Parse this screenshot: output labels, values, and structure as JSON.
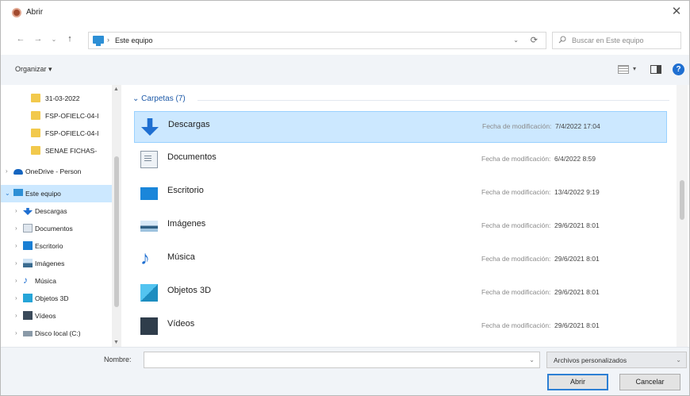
{
  "window": {
    "title": "Abrir"
  },
  "address": {
    "path": "Este equipo",
    "search_placeholder": "Buscar en Este equipo"
  },
  "toolbar": {
    "organize_label": "Organizar ▾"
  },
  "nav": {
    "items": [
      {
        "label": "31-03-2022",
        "icon": "folder-icon"
      },
      {
        "label": "FSP-OFIELC-04-I",
        "icon": "folder-icon"
      },
      {
        "label": "FSP-OFIELC-04-I",
        "icon": "folder-icon"
      },
      {
        "label": "SENAE FICHAS-",
        "icon": "folder-icon"
      },
      {
        "label": "OneDrive - Person",
        "icon": "cloud-icon"
      },
      {
        "label": "Este equipo",
        "icon": "pc-icon",
        "selected": true
      },
      {
        "label": "Descargas",
        "icon": "download-icon"
      },
      {
        "label": "Documentos",
        "icon": "document-icon"
      },
      {
        "label": "Escritorio",
        "icon": "desktop-icon"
      },
      {
        "label": "Imágenes",
        "icon": "image-icon"
      },
      {
        "label": "Música",
        "icon": "music-icon"
      },
      {
        "label": "Objetos 3D",
        "icon": "object3d-icon"
      },
      {
        "label": "Vídeos",
        "icon": "video-icon"
      },
      {
        "label": "Disco local (C:)",
        "icon": "disk-icon"
      }
    ]
  },
  "main": {
    "group_header": "Carpetas (7)",
    "mod_label": "Fecha de modificación:",
    "rows": [
      {
        "name": "Descargas",
        "date": "7/4/2022 17:04",
        "icon": "download-icon",
        "selected": true
      },
      {
        "name": "Documentos",
        "date": "6/4/2022 8:59",
        "icon": "document-icon"
      },
      {
        "name": "Escritorio",
        "date": "13/4/2022 9:19",
        "icon": "desktop-icon"
      },
      {
        "name": "Imágenes",
        "date": "29/6/2021 8:01",
        "icon": "image-icon"
      },
      {
        "name": "Música",
        "date": "29/6/2021 8:01",
        "icon": "music-icon"
      },
      {
        "name": "Objetos 3D",
        "date": "29/6/2021 8:01",
        "icon": "object3d-icon"
      },
      {
        "name": "Vídeos",
        "date": "29/6/2021 8:01",
        "icon": "video-icon"
      }
    ]
  },
  "bottom": {
    "name_label": "Nombre:",
    "name_value": "",
    "filter_value": "Archivos personalizados",
    "open_label": "Abrir",
    "cancel_label": "Cancelar"
  },
  "colors": {
    "selection": "#cce8ff",
    "accent": "#1f6fd1",
    "link": "#1e5aa8"
  }
}
